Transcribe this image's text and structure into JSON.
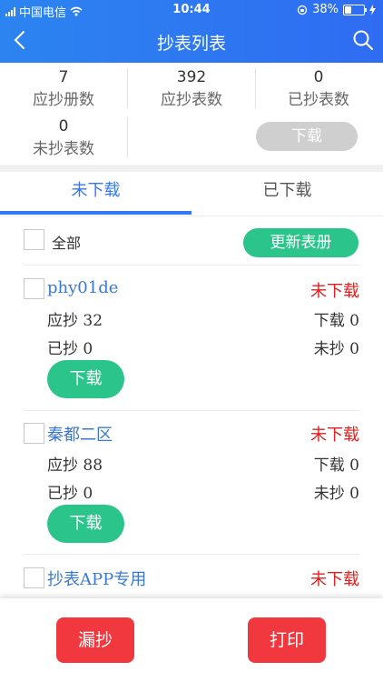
{
  "status_bar": {
    "carrier": "中国电信",
    "time": "10:44",
    "battery": "38%",
    "battery_level": 0.38
  },
  "nav": {
    "title": "抄表列表"
  },
  "stats": {
    "books_due": {
      "value": "7",
      "label": "应抄册数"
    },
    "meters_due": {
      "value": "392",
      "label": "应抄表数"
    },
    "meters_read": {
      "value": "0",
      "label": "已抄表数"
    },
    "meters_unread": {
      "value": "0",
      "label": "未抄表数"
    },
    "download_label": "下载"
  },
  "tabs": {
    "not_downloaded": "未下载",
    "downloaded": "已下载"
  },
  "list_header": {
    "select_all": "全部",
    "update_books": "更新表册"
  },
  "rows": [
    {
      "name": "phy01de",
      "status": "未下载",
      "due": "应抄 32",
      "downloaded": "下载 0",
      "read": "已抄 0",
      "unread": "未抄 0",
      "button": "下载"
    },
    {
      "name": "秦都二区",
      "status": "未下载",
      "due": "应抄 88",
      "downloaded": "下载 0",
      "read": "已抄 0",
      "unread": "未抄 0",
      "button": "下载"
    },
    {
      "name": "抄表APP专用",
      "status": "未下载"
    }
  ],
  "bottom": {
    "missed": "漏抄",
    "print": "打印"
  },
  "colors": {
    "header": "#2f7af2",
    "accent_blue": "#3478f6",
    "green": "#2bc48b",
    "red": "#f2383f",
    "status_red": "#e02020"
  }
}
